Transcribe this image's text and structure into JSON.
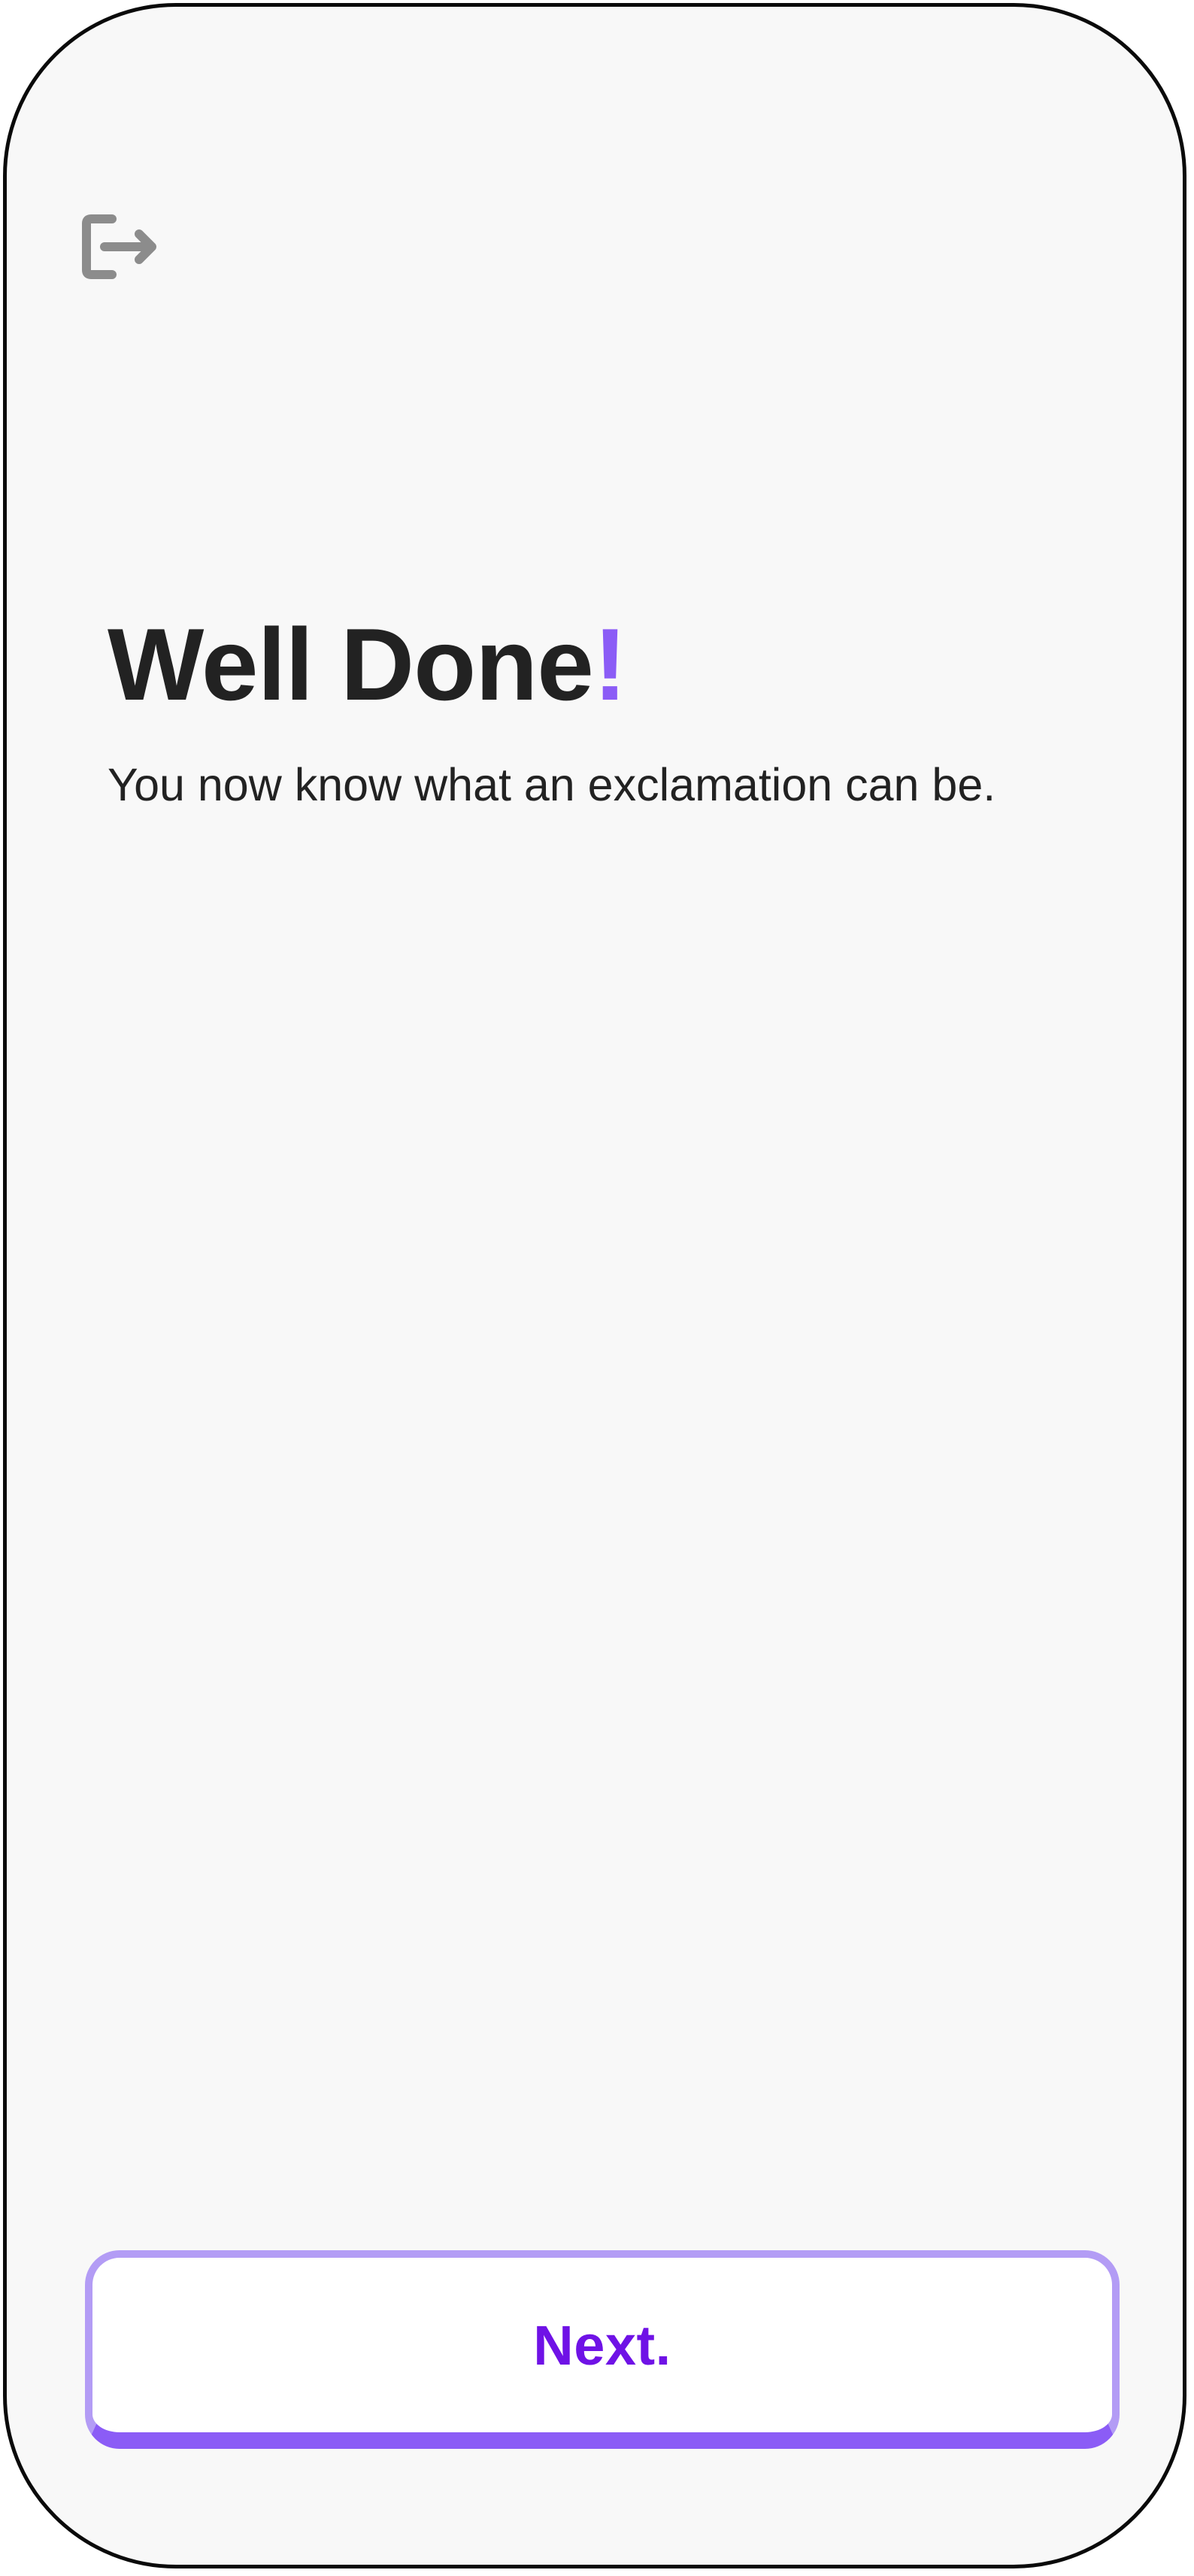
{
  "header": {
    "exit_icon": "exit-icon"
  },
  "main": {
    "title_text": "Well Done",
    "title_punctuation": "!",
    "subtitle": "You now know what an exclamation can be."
  },
  "footer": {
    "next_label": "Next."
  },
  "colors": {
    "accent": "#8b5cf6",
    "accent_light": "#b39cf5",
    "button_text": "#6f12e6",
    "text": "#222222",
    "icon": "#8c8c8c",
    "background": "#f8f8f8"
  }
}
